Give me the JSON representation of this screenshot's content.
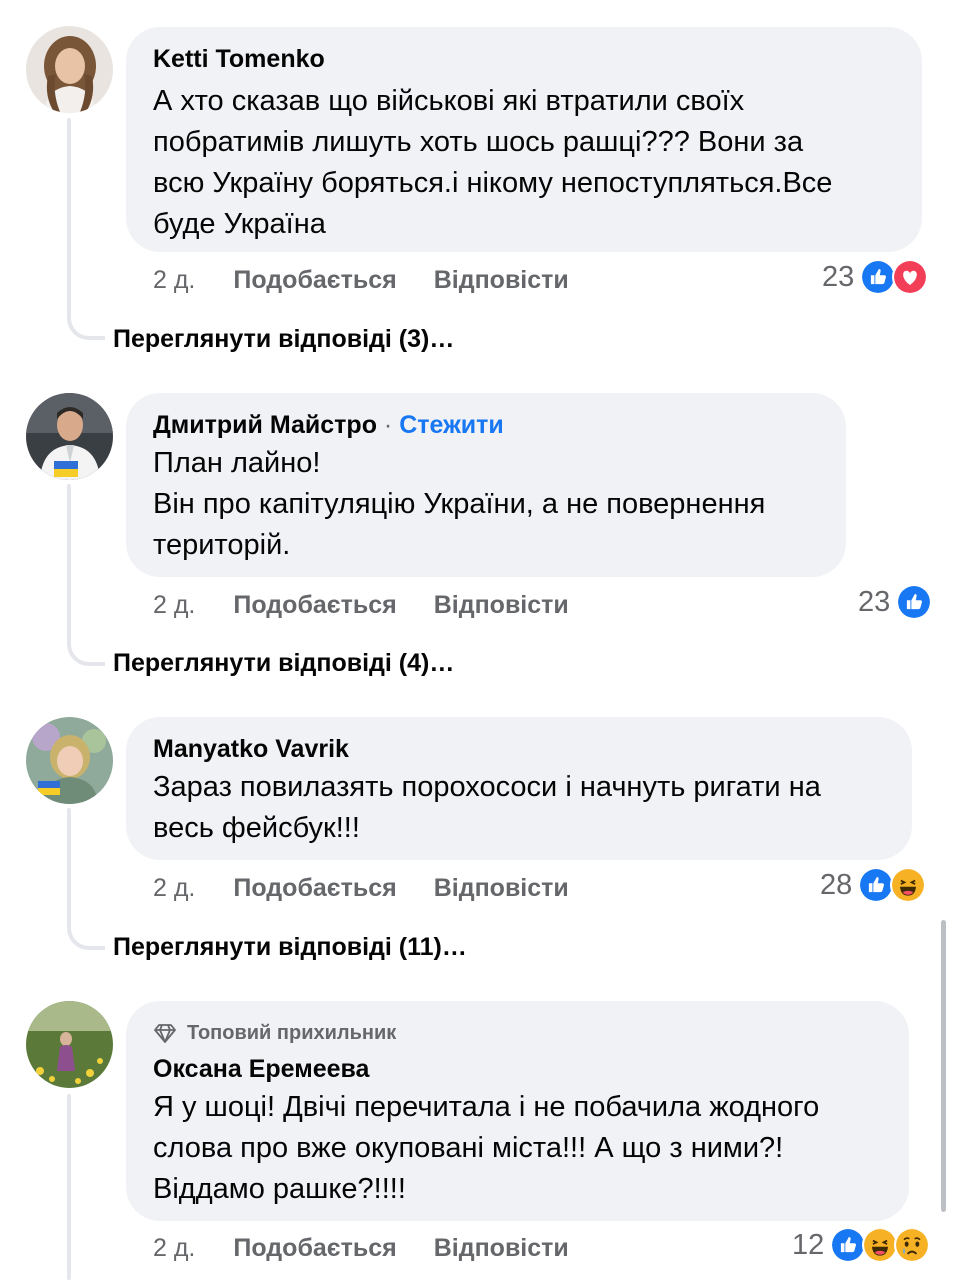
{
  "colors": {
    "link": "#1877f2",
    "muted": "#65676b",
    "bubble": "#f0f2f5"
  },
  "comments": [
    {
      "author": "Ketti Tomenko",
      "text": "А хто сказав що військові які втратили своїх\nпобратимів лишуть хоть шось рашці??? Вони за\nвсю Україну боряться.і нікому непоступляться.Все\nбуде Україна",
      "time": "2 д.",
      "like_label": "Подобається",
      "reply_label": "Відповісти",
      "reaction_count": "23",
      "reactions": [
        "like-icon",
        "love-icon"
      ],
      "view_replies": "Переглянути відповіді (3)…"
    },
    {
      "author": "Дмитрий Майстро",
      "follow_separator": "·",
      "follow_label": "Стежити",
      "text": "План лайно!\nВін про капітуляцію України, а не повернення\nтериторій.",
      "time": "2 д.",
      "like_label": "Подобається",
      "reply_label": "Відповісти",
      "reaction_count": "23",
      "reactions": [
        "like-icon"
      ],
      "view_replies": "Переглянути відповіді (4)…"
    },
    {
      "author": "Manyatko Vavrik",
      "text": "Зараз повилазять порохососи і начнуть ригати на\nвесь фейсбук!!!",
      "time": "2 д.",
      "like_label": "Подобається",
      "reply_label": "Відповісти",
      "reaction_count": "28",
      "reactions": [
        "like-icon",
        "haha-icon"
      ],
      "view_replies": "Переглянути відповіді (11)…"
    },
    {
      "badge": "Топовий прихильник",
      "author": "Оксана Еремеева",
      "text": "Я у шоці! Двічі перечитала і не побачила жодного\nслова про вже окуповані міста!!! А що з ними?!\nВіддамо рашке?!!!!",
      "time": "2 д.",
      "like_label": "Подобається",
      "reply_label": "Відповісти",
      "reaction_count": "12",
      "reactions": [
        "like-icon",
        "haha-icon",
        "sad-icon"
      ]
    }
  ]
}
